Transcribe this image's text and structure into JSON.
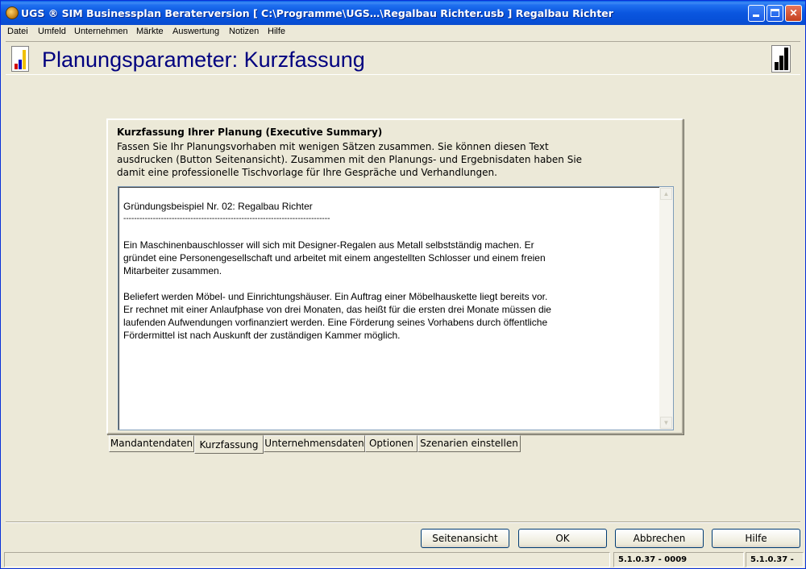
{
  "window": {
    "title": "UGS ® SIM Businessplan Beraterversion   [ C:\\Programme\\UGS…\\Regalbau Richter.usb ] Regalbau Richter",
    "icon": "app-icon"
  },
  "menu": {
    "items": [
      "Datei",
      "Umfeld",
      "Unternehmen",
      "Märkte",
      "Auswertung",
      "Notizen",
      "Hilfe"
    ]
  },
  "header": {
    "title": "Planungsparameter: Kurzfassung"
  },
  "panel": {
    "heading": "Kurzfassung Ihrer Planung (Executive Summary)",
    "description": [
      "Fassen Sie Ihr Planungsvorhaben mit wenigen Sätzen zusammen. Sie können diesen Text",
      "ausdrucken (Button Seitenansicht). Zusammen mit den Planungs- und Ergebnisdaten haben Sie",
      "damit eine professionelle Tischvorlage für Ihre Gespräche und Verhandlungen."
    ],
    "text_lines": [
      "Gründungsbeispiel Nr. 02: Regalbau Richter",
      "-----------------------------------------------------------------------------",
      "",
      "Ein Maschinenbauschlosser will sich mit Designer-Regalen aus Metall selbstständig machen. Er",
      "gründet eine Personengesellschaft und arbeitet mit einem angestellten Schlosser und einem freien",
      "Mitarbeiter zusammen.",
      "",
      "Beliefert werden Möbel- und Einrichtungshäuser. Ein Auftrag einer Möbelhauskette liegt bereits vor.",
      "Er rechnet mit einer Anlaufphase von drei Monaten, das heißt für die ersten drei Monate müssen die",
      "laufenden Aufwendungen vorfinanziert werden. Eine Förderung seines Vorhabens durch öffentliche",
      "Fördermittel ist nach Auskunft der zuständigen Kammer möglich."
    ]
  },
  "tabs": {
    "items": [
      "Mandantendaten",
      "Kurzfassung",
      "Unternehmensdaten",
      "Optionen",
      "Szenarien einstellen"
    ],
    "active": "Kurzfassung"
  },
  "buttons": {
    "seitenansicht": "Seitenansicht",
    "ok": "OK",
    "abbrechen": "Abbrechen",
    "hilfe": "Hilfe"
  },
  "status": {
    "version_left": "5.1.0.37 - 0009",
    "version_right": "5.1.0.37 -"
  },
  "colors": {
    "titlebar": "#0a56df",
    "header_title": "#00007f",
    "background": "#ece9d8"
  }
}
